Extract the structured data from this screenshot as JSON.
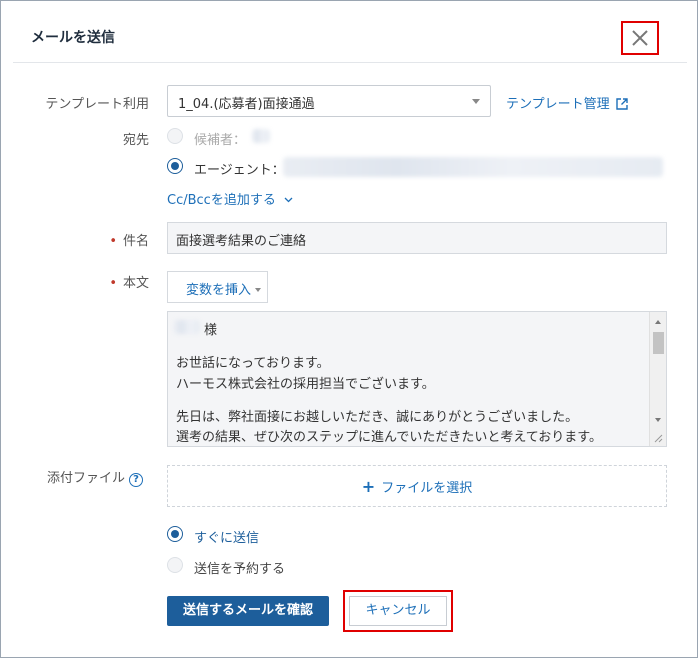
{
  "dialog": {
    "title": "メールを送信"
  },
  "template": {
    "label": "テンプレート利用",
    "selected": "1_04.(応募者)面接通過",
    "manage_link": "テンプレート管理"
  },
  "recipient": {
    "label": "宛先",
    "candidate": "候補者：",
    "agent": "エージェント：",
    "add_cc": "Cc/Bccを追加する"
  },
  "subject": {
    "label": "件名",
    "value": "面接選考結果のご連絡"
  },
  "body": {
    "label": "本文",
    "insert_variable": "変数を挿入",
    "lines": [
      "様",
      "",
      "お世話になっております。",
      "ハーモス株式会社の採用担当でございます。",
      "",
      "先日は、弊社面接にお越しいただき、誠にありがとうございました。",
      "選考の結果、ぜひ次のステップに進んでいただきたいと考えております。"
    ]
  },
  "attachment": {
    "label": "添付ファイル",
    "button": "ファイルを選択"
  },
  "send_timing": {
    "now": "すぐに送信",
    "schedule": "送信を予約する"
  },
  "actions": {
    "confirm": "送信するメールを確認",
    "cancel": "キャンセル"
  },
  "colors": {
    "primary": "#1d5e9b",
    "link": "#1d6fb8",
    "highlight": "#e00000",
    "required": "#c0392b"
  }
}
